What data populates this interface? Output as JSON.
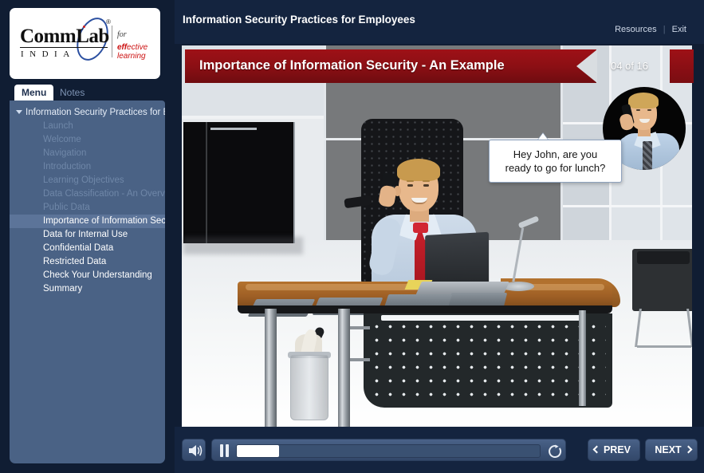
{
  "app": {
    "course_title": "Information Security Practices for Employees",
    "brand": {
      "logo_main": "CommLab",
      "logo_sub": "INDIA",
      "tagline_line1": "for",
      "tagline_em": "eff",
      "tagline_rest": "ective learning",
      "registered_mark": "®"
    }
  },
  "header": {
    "title": "Information Security Practices for Employees",
    "resources_label": "Resources",
    "separator": "|",
    "exit_label": "Exit"
  },
  "sidebar": {
    "tabs": [
      {
        "label": "Menu",
        "active": true
      },
      {
        "label": "Notes",
        "active": false
      }
    ],
    "root_label": "Information Security Practices for E...",
    "items": [
      {
        "label": "Launch",
        "state": "visited"
      },
      {
        "label": "Welcome",
        "state": "visited"
      },
      {
        "label": "Navigation",
        "state": "visited"
      },
      {
        "label": "Introduction",
        "state": "visited"
      },
      {
        "label": "Learning Objectives",
        "state": "visited"
      },
      {
        "label": "Data Classification - An Overview",
        "state": "visited"
      },
      {
        "label": "Public Data",
        "state": "visited"
      },
      {
        "label": "Importance of Information Securit...",
        "state": "active"
      },
      {
        "label": "Data for Internal Use",
        "state": "normal"
      },
      {
        "label": "Confidential Data",
        "state": "normal"
      },
      {
        "label": "Restricted Data",
        "state": "normal"
      },
      {
        "label": "Check Your Understanding",
        "state": "normal"
      },
      {
        "label": "Summary",
        "state": "normal"
      }
    ]
  },
  "slide": {
    "title": "Importance of Information Security - An Example",
    "counter": "04 of 16",
    "current_page": 4,
    "total_pages": 16,
    "speech_bubble": "Hey John, are you ready to go for lunch?",
    "speech_line1": "Hey John, are you",
    "speech_line2": "ready to go for lunch?"
  },
  "controls": {
    "volume_icon": "speaker-icon",
    "pause_icon": "pause-icon",
    "replay_icon": "replay-icon",
    "progress_percent": 14,
    "prev_label": "PREV",
    "next_label": "NEXT"
  },
  "colors": {
    "chrome_navy": "#14243f",
    "sidebar_panel": "#4a6285",
    "active_item": "#5c7499",
    "ribbon_red": "#9e1117",
    "accent_white": "#ffffff"
  }
}
